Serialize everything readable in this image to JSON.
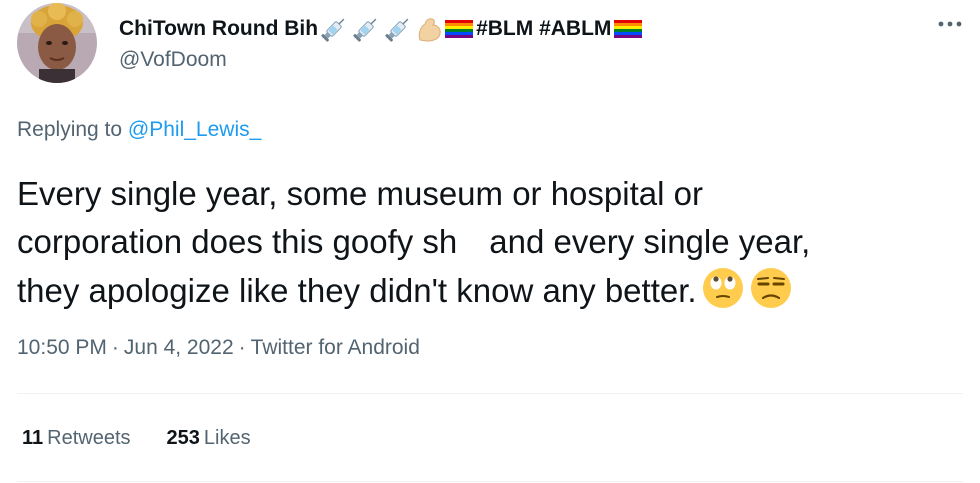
{
  "author": {
    "display_name": "ChiTown Round Bih",
    "hashtags": "#BLM #ABLM",
    "handle": "@VofDoom",
    "name_emojis": [
      "syringe-icon",
      "syringe-icon",
      "syringe-icon",
      "flexed-biceps-icon",
      "rainbow-flag-icon",
      "rainbow-flag-icon"
    ],
    "avatar": "avatar"
  },
  "more_options": "more-options-icon",
  "reply": {
    "prefix": "Replying to ",
    "to_handle": "@Phil_Lewis_"
  },
  "tweet": {
    "line1": "Every single year, some museum or hospital or",
    "line2a": "corporation does this goofy sh",
    "line2b": "and every single year,",
    "line3": "they apologize like they didn't know any better.",
    "emojis": [
      "face-with-rolling-eyes-icon",
      "unamused-face-icon"
    ]
  },
  "meta": {
    "time": "10:50 PM",
    "separator": "·",
    "date": "Jun 4, 2022",
    "source": "Twitter for Android"
  },
  "stats": {
    "retweets_count": "11",
    "retweets_label": "Retweets",
    "likes_count": "253",
    "likes_label": "Likes"
  },
  "colors": {
    "text": "#0f1419",
    "secondary": "#536471",
    "link": "#1d9bf0",
    "divider": "#eff3f4"
  }
}
